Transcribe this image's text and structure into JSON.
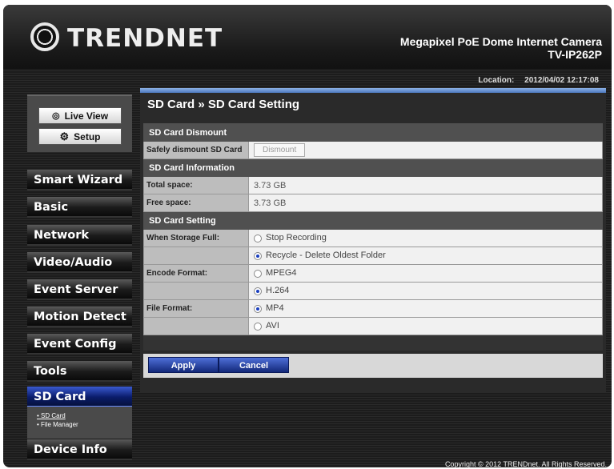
{
  "header": {
    "brand": "TRENDNET",
    "product_line1": "Megapixel PoE Dome Internet Camera",
    "product_line2": "TV-IP262P"
  },
  "location": {
    "label": "Location:",
    "timestamp": "2012/04/02 12:17:08"
  },
  "topnav": {
    "live_view": "Live View",
    "setup": "Setup"
  },
  "sidebar": {
    "items": [
      {
        "label": "Smart Wizard"
      },
      {
        "label": "Basic"
      },
      {
        "label": "Network"
      },
      {
        "label": "Video/Audio"
      },
      {
        "label": "Event Server"
      },
      {
        "label": "Motion Detect"
      },
      {
        "label": "Event Config"
      },
      {
        "label": "Tools"
      },
      {
        "label": "SD Card"
      },
      {
        "label": "Device Info"
      }
    ],
    "sub": [
      {
        "label": "• SD Card"
      },
      {
        "label": "• File Manager"
      }
    ]
  },
  "page": {
    "title": "SD Card » SD Card Setting"
  },
  "sections": {
    "dismount": {
      "title": "SD Card Dismount",
      "label": "Safely dismount SD Card",
      "button": "Dismount"
    },
    "info": {
      "title": "SD Card Information",
      "total_label": "Total space:",
      "total_value": "3.73 GB",
      "free_label": "Free space:",
      "free_value": "3.73 GB"
    },
    "setting": {
      "title": "SD Card Setting",
      "storage_label": "When Storage Full:",
      "storage_opt1": "Stop Recording",
      "storage_opt2": "Recycle - Delete Oldest Folder",
      "encode_label": "Encode Format:",
      "encode_opt1": "MPEG4",
      "encode_opt2": "H.264",
      "file_label": "File Format:",
      "file_opt1": "MP4",
      "file_opt2": "AVI"
    }
  },
  "actions": {
    "apply": "Apply",
    "cancel": "Cancel"
  },
  "footer": {
    "copyright": "Copyright © 2012 TRENDnet. All Rights Reserved."
  }
}
